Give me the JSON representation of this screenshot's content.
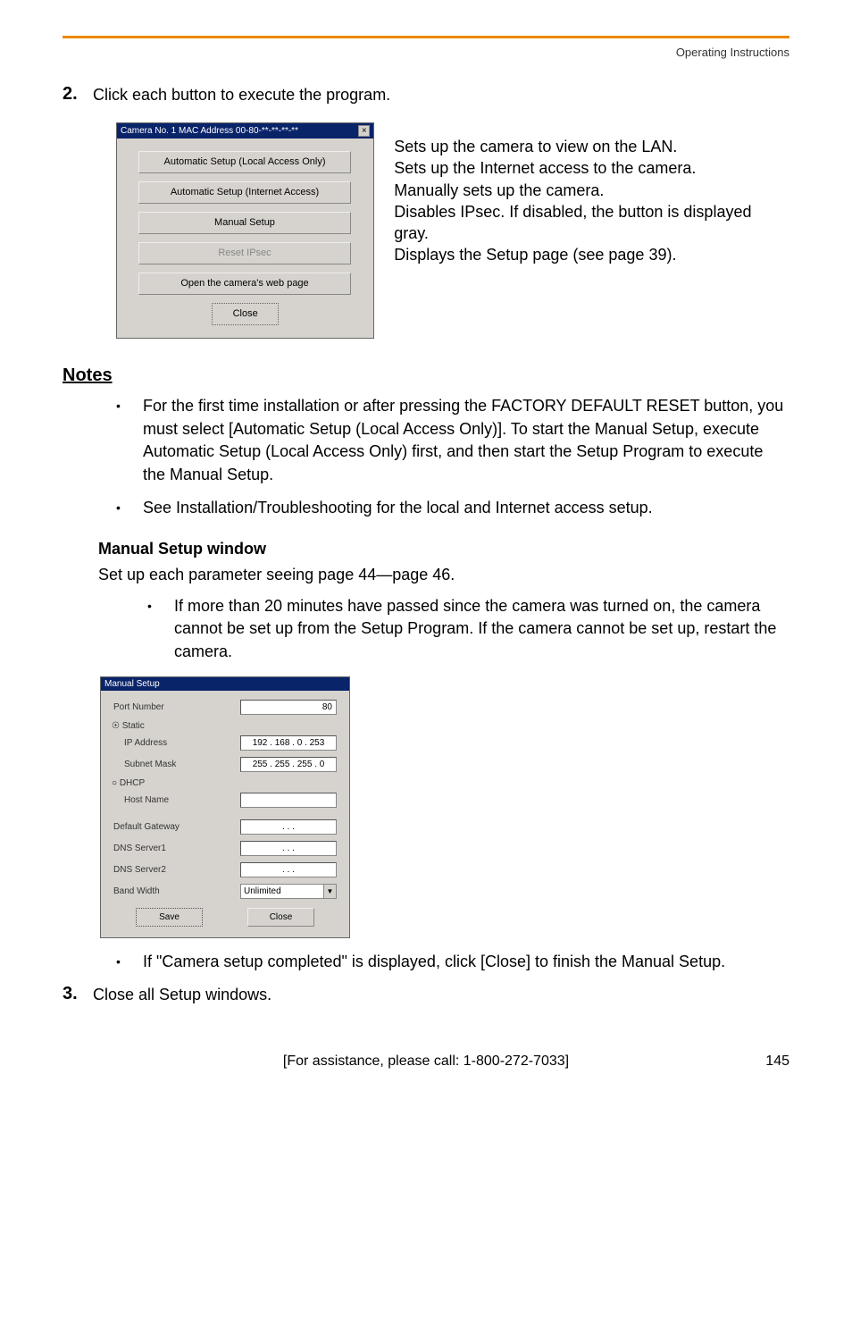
{
  "header": {
    "text": "Operating Instructions"
  },
  "step2": {
    "num": "2.",
    "text": "Click each button to execute the program."
  },
  "dialog1": {
    "title": "Camera No. 1     MAC Address   00-80-**-**-**-**",
    "buttons": {
      "auto_local": "Automatic Setup (Local Access Only)",
      "auto_internet": "Automatic Setup (Internet Access)",
      "manual": "Manual Setup",
      "reset_ipsec": "Reset IPsec",
      "open_web": "Open the camera's web page",
      "close": "Close"
    }
  },
  "annotations": {
    "a1": "Sets up the camera to view on the LAN.",
    "a2": "Sets up the Internet access to the camera.",
    "a3": "Manually sets up the camera.",
    "a4": "Disables IPsec. If disabled, the button is displayed gray.",
    "a5": "Displays the Setup page (see page 39)."
  },
  "notes": {
    "heading": "Notes",
    "items": [
      "For the first time installation or after pressing the FACTORY DEFAULT RESET button, you must select [Automatic Setup (Local Access Only)]. To start the Manual Setup, execute Automatic Setup (Local Access Only) first, and then start the Setup Program to execute the Manual Setup.",
      "See Installation/Troubleshooting for the local and Internet access setup."
    ]
  },
  "manual_section": {
    "heading": "Manual Setup window",
    "intro": "Set up each parameter seeing page 44—page 46.",
    "sub_bullet": "If more than 20 minutes have passed since the camera was turned on, the camera cannot be set up from the Setup Program. If the camera cannot be set up, restart the camera."
  },
  "manual_dialog": {
    "title": "Manual Setup",
    "labels": {
      "port": "Port Number",
      "static": "Static",
      "ip": "IP Address",
      "subnet": "Subnet Mask",
      "dhcp": "DHCP",
      "host": "Host Name",
      "gateway": "Default Gateway",
      "dns1": "DNS Server1",
      "dns2": "DNS Server2",
      "band": "Band Width"
    },
    "values": {
      "port": "80",
      "ip": "192 . 168 .  0  . 253",
      "subnet": "255 . 255 . 255 .  0",
      "host": "",
      "gateway": ".       .       .",
      "dns1": ".       .       .",
      "dns2": ".       .       .",
      "band": "Unlimited"
    },
    "buttons": {
      "save": "Save",
      "close": "Close"
    }
  },
  "post_bullet": "If \"Camera setup completed\" is displayed, click [Close] to finish the Manual Setup.",
  "step3": {
    "num": "3.",
    "text": "Close all Setup windows."
  },
  "footer": {
    "assist": "[For assistance, please call: 1-800-272-7033]",
    "page": "145"
  }
}
